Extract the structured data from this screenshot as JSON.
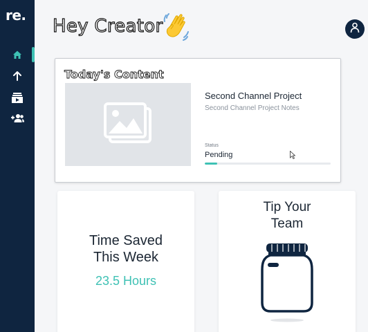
{
  "brand": {
    "logo_text": "re."
  },
  "sidebar": {
    "items": [
      {
        "name": "home",
        "icon": "home-icon",
        "active": true
      },
      {
        "name": "upload",
        "icon": "arrow-up-icon",
        "active": false
      },
      {
        "name": "content",
        "icon": "content-library-icon",
        "active": false
      },
      {
        "name": "team",
        "icon": "add-team-icon",
        "active": false
      }
    ]
  },
  "header": {
    "greeting": "Hey Creator",
    "emoji": "waving-hand"
  },
  "todays_content": {
    "title": "Today's Content",
    "project_title": "Second Channel Project",
    "project_notes": "Second Channel Project Notes",
    "status_label": "Status",
    "status_value": "Pending",
    "progress": 0.1
  },
  "time_saved": {
    "title_line1": "Time Saved",
    "title_line2": "This Week",
    "value": "23.5 Hours"
  },
  "tip_team": {
    "title_line1": "Tip Your",
    "title_line2": "Team"
  },
  "colors": {
    "sidebar_bg": "#0f2540",
    "accent": "#3ec1b4",
    "text_dark": "#1b2633"
  }
}
